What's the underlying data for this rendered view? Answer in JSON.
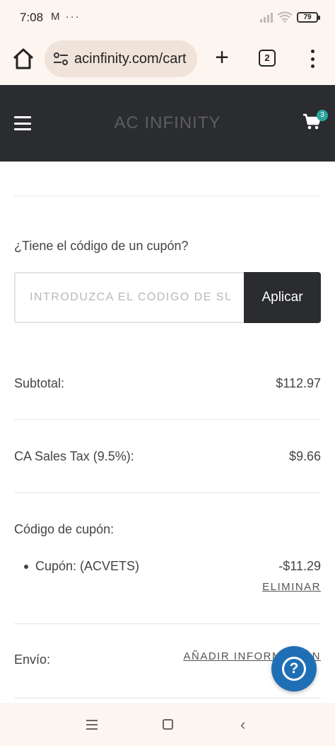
{
  "status_bar": {
    "time": "7:08",
    "notification_icons": "M ···",
    "battery": "79"
  },
  "browser": {
    "url": "acinfinity.com/cart",
    "tab_count": "2",
    "new_tab_symbol": "+"
  },
  "site": {
    "brand": "AC INFINITY",
    "cart_count": "3"
  },
  "coupon": {
    "question": "¿Tiene el código de un cupón?",
    "placeholder": "INTRODUZCA EL CÓDIGO DE SU CUPÓN",
    "apply_label": "Aplicar"
  },
  "summary": {
    "subtotal_label": "Subtotal:",
    "subtotal_value": "$112.97",
    "tax_label": "CA Sales Tax (9.5%):",
    "tax_value": "$9.66",
    "coupon_code_label": "Código de cupón:",
    "coupon_item_label": "Cupón: (ACVETS)",
    "coupon_item_value": "-$11.29",
    "remove_label": "ELIMINAR",
    "shipping_label": "Envío:",
    "shipping_action": "AÑADIR INFORMACIÓN"
  },
  "help": {
    "symbol": "?"
  },
  "nav": {
    "back_symbol": "‹"
  }
}
